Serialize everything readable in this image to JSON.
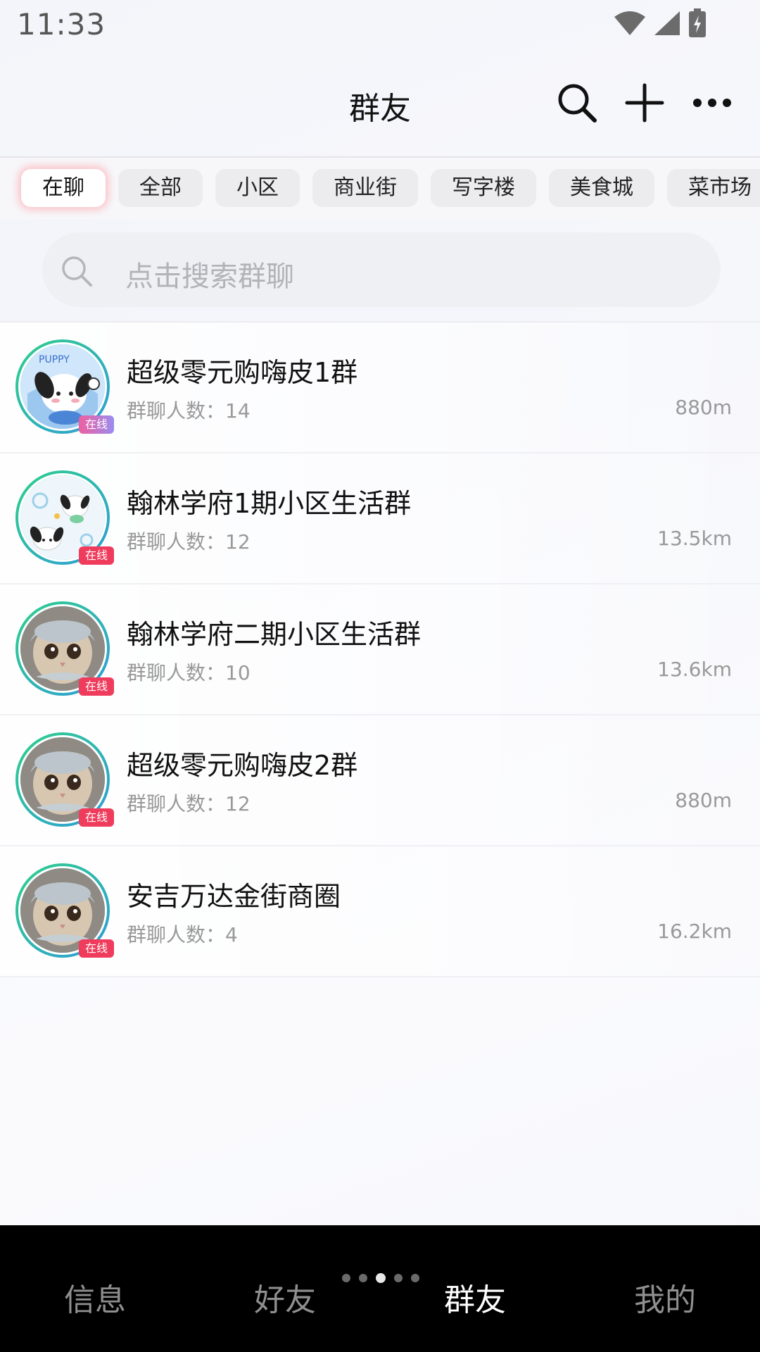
{
  "status_bar": {
    "time": "11:33"
  },
  "header": {
    "title": "群友",
    "actions": [
      "search-icon",
      "plus-icon",
      "more-icon"
    ]
  },
  "chips": [
    {
      "label": "在聊",
      "active": true
    },
    {
      "label": "全部",
      "active": false
    },
    {
      "label": "小区",
      "active": false
    },
    {
      "label": "商业街",
      "active": false
    },
    {
      "label": "写字楼",
      "active": false
    },
    {
      "label": "美食城",
      "active": false
    },
    {
      "label": "菜市场",
      "active": false
    }
  ],
  "search": {
    "placeholder": "点击搜索群聊"
  },
  "groups": [
    {
      "name": "超级零元购嗨皮1群",
      "members": "群聊人数：14",
      "distance": "880m",
      "badge": "在线",
      "avatar": "puppy-avatar"
    },
    {
      "name": "翰林学府1期小区生活群",
      "members": "群聊人数：12",
      "distance": "13.5km",
      "badge": "在线",
      "avatar": "puppy-pattern-avatar"
    },
    {
      "name": "翰林学府二期小区生活群",
      "members": "群聊人数：10",
      "distance": "13.6km",
      "badge": "在线",
      "avatar": "cat-avatar"
    },
    {
      "name": "超级零元购嗨皮2群",
      "members": "群聊人数：12",
      "distance": "880m",
      "badge": "在线",
      "avatar": "cat-avatar"
    },
    {
      "name": "安吉万达金街商圈",
      "members": "群聊人数：4",
      "distance": "16.2km",
      "badge": "在线",
      "avatar": "cat-avatar"
    }
  ],
  "bottom_nav": {
    "tabs": [
      {
        "label": "信息",
        "active": false
      },
      {
        "label": "好友",
        "active": false
      },
      {
        "label": "群友",
        "active": true
      },
      {
        "label": "我的",
        "active": false
      }
    ],
    "dots_count": 5,
    "dots_active": 2
  },
  "colors": {
    "badge_red": "#ef3c5c",
    "avatar_ring": "#2fd08a",
    "nav_background": "#000000",
    "chip_glow": "#ff6e78"
  }
}
